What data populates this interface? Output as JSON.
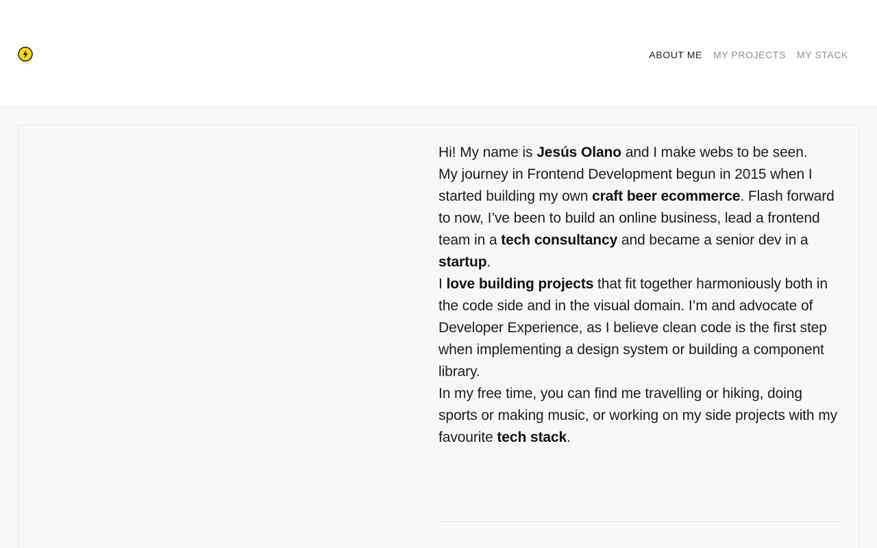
{
  "brand": {
    "logo_icon": "lightning-bolt-icon",
    "logo_color": "#f5d90a"
  },
  "nav": {
    "items": [
      {
        "label": "ABOUT ME",
        "active": true
      },
      {
        "label": "MY PROJECTS",
        "active": false
      },
      {
        "label": "MY STACK",
        "active": false
      }
    ]
  },
  "bio": {
    "p1": {
      "t1": "Hi! My name is ",
      "name": "Jesús Olano",
      "t2": " and I make webs to be seen."
    },
    "p2": {
      "t1": "My journey in Frontend Development begun in 2015 when I started building my own ",
      "b1": "craft beer ecommerce",
      "t2": ". Flash forward to now, I’ve been to build an online business, lead a frontend team in a ",
      "b2": "tech consultancy",
      "t3": " and became a senior dev in a ",
      "b3": "startup",
      "t4": "."
    },
    "p3": {
      "t1": "I ",
      "b1": "love building projects",
      "t2": " that fit together harmoniously both in the code side and in the visual domain. I’m and advocate of Developer Experience, as I believe clean code is the first step when implementing a design system or building a component library."
    },
    "p4": {
      "t1": "In my free time, you can find me travelling or hiking, doing sports or making music, or working on my side projects with my favourite ",
      "b1": "tech stack",
      "t2": "."
    }
  }
}
